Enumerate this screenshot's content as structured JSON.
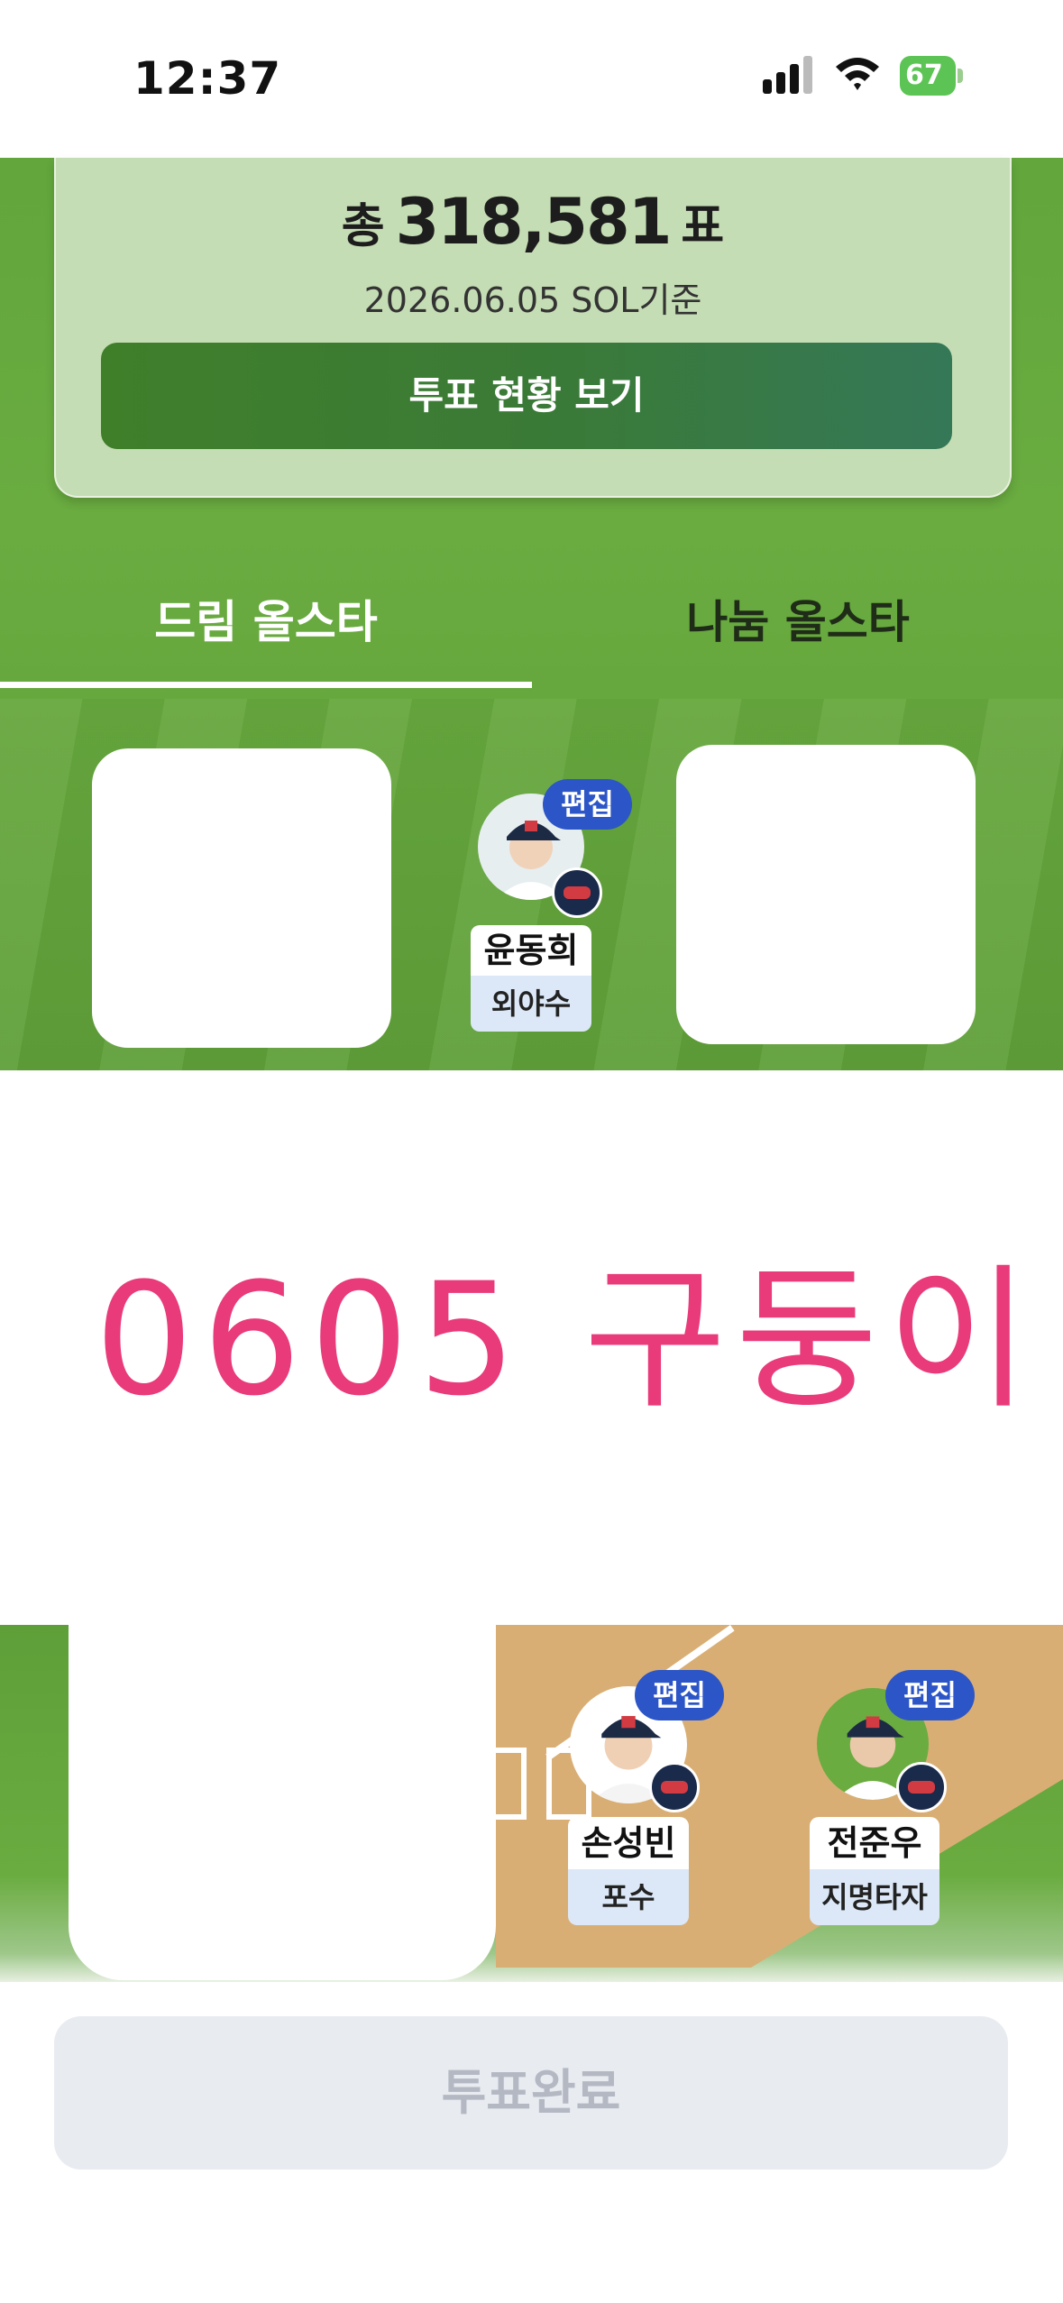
{
  "status_bar": {
    "time": "12:37",
    "battery": "67"
  },
  "summary": {
    "total_prefix": "총",
    "total_votes": "318,581",
    "total_suffix": "표",
    "basis_date": "2026.06.05 SOL기준",
    "view_button": "투표 현황 보기"
  },
  "tabs": [
    {
      "label": "드림 올스타",
      "selected": true
    },
    {
      "label": "나눔 올스타",
      "selected": false
    }
  ],
  "players": [
    {
      "name": "윤동희",
      "position": "외야수",
      "edit": "편집"
    },
    {
      "name": "손성빈",
      "position": "포수",
      "edit": "편집"
    },
    {
      "name": "전준우",
      "position": "지명타자",
      "edit": "편집"
    }
  ],
  "overlay_text": "0605 구둥이",
  "complete_button": "투표완료",
  "colors": {
    "field_green": "#66a83d",
    "edit_badge": "#2c55c7",
    "overlay_pink": "#e93a7a",
    "button_dark_green": "#3f7f2a"
  }
}
